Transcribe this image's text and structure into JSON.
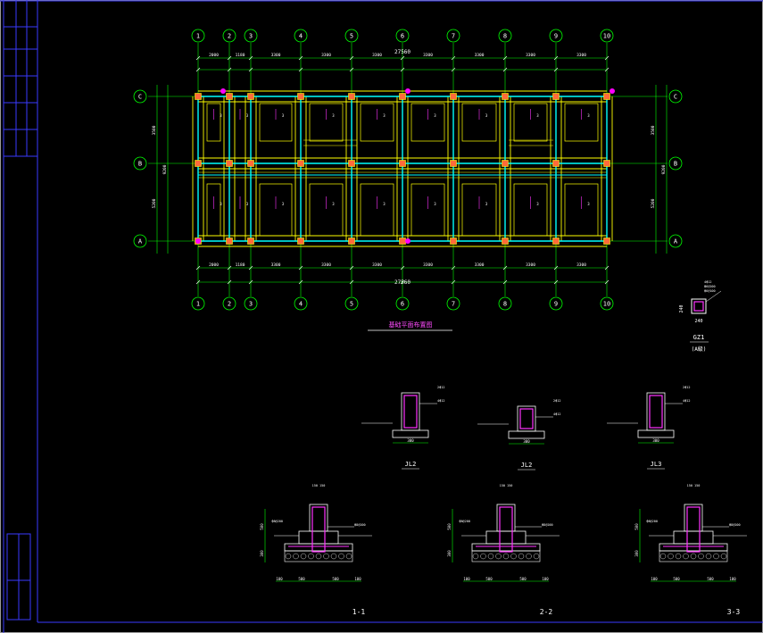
{
  "plan": {
    "axes_x": [
      "1",
      "2",
      "3",
      "4",
      "5",
      "6",
      "7",
      "8",
      "9",
      "10"
    ],
    "axes_y": [
      "C",
      "B",
      "A"
    ],
    "overall_length": "27560",
    "top_spans": [
      "2000",
      "1180",
      "3300",
      "3300",
      "3300",
      "3300",
      "3300",
      "3300",
      "3300"
    ],
    "bottom_spans": [
      "2000",
      "1180",
      "3300",
      "3300",
      "3300",
      "3300",
      "3300",
      "3300",
      "3300"
    ],
    "left_dims": [
      "3500",
      "5200",
      "9200"
    ],
    "right_dims": [
      "3500",
      "5200",
      "9200"
    ],
    "caption": "基础平面布置图"
  },
  "column": {
    "label": "GZ1",
    "sublabel": "(A級)",
    "w": "240",
    "h": "240"
  },
  "sections": {
    "jl": [
      "JL2",
      "JL2",
      "JL3"
    ],
    "foundation": [
      "1-1",
      "2-2",
      "3-3"
    ],
    "dims": [
      "100",
      "500",
      "500",
      "100"
    ]
  },
  "colors": {
    "background": "#000000",
    "axis": "#00ff00",
    "beam": "#ffff00",
    "wall": "#00ffff",
    "rebar": "#ff00ff",
    "border": "#0000ff",
    "text": "#ffffff"
  }
}
